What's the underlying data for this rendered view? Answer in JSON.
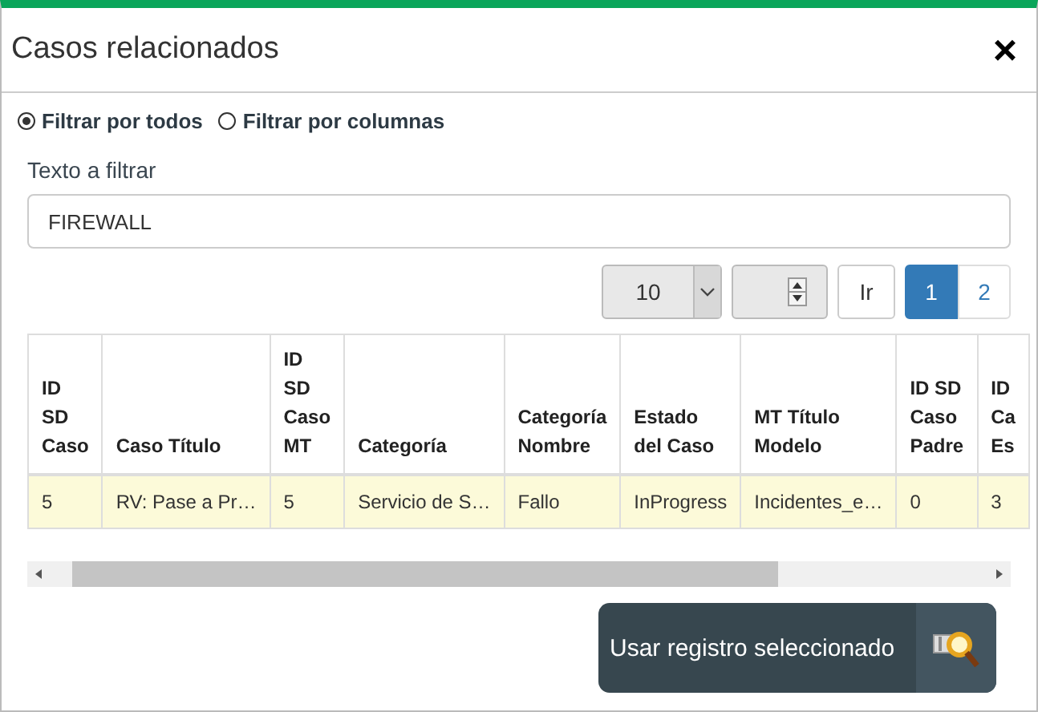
{
  "dialog": {
    "title": "Casos relacionados",
    "close": "×"
  },
  "filter_modes": [
    {
      "label": "Filtrar por todos",
      "selected": true
    },
    {
      "label": "Filtrar por columnas",
      "selected": false
    }
  ],
  "filter": {
    "label": "Texto a filtrar",
    "value": "FIREWALL"
  },
  "pager": {
    "page_size": "10",
    "go": "Ir",
    "pages": [
      {
        "label": "1",
        "selected": true
      },
      {
        "label": "2",
        "selected": false
      }
    ]
  },
  "table": {
    "columns": [
      "ID SD Caso",
      "Caso Título",
      "ID SD Caso MT",
      "Categoría",
      "Categoría Nombre",
      "Estado del Caso",
      "MT Título Modelo",
      "ID SD Caso Padre",
      "ID Ca Es"
    ],
    "rows": [
      {
        "selected": true,
        "cells": [
          "5",
          "RV: Pase a Pr…",
          "5",
          "Servicio de S…",
          "Fallo",
          "InProgress",
          "Incidentes_e…",
          "0",
          "3"
        ]
      }
    ]
  },
  "action_button": "Usar registro seleccionado"
}
